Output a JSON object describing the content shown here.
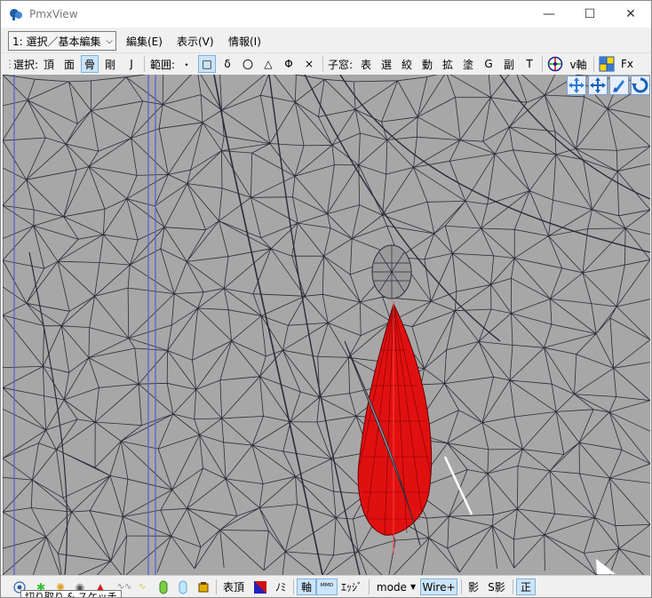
{
  "window": {
    "title": "PmxView",
    "minimize": "—",
    "maximize": "☐",
    "close": "✕"
  },
  "menu": {
    "mode_select": "1: 選択／基本編集",
    "items": [
      "編集(E)",
      "表示(V)",
      "情報(I)"
    ]
  },
  "toolbar": {
    "select_label": "選択:",
    "select_items": [
      "頂",
      "面",
      "骨",
      "剛",
      "J"
    ],
    "range_label": "範囲:",
    "range_items": [
      "・",
      "□",
      "δ",
      "〇",
      "△",
      "Φ",
      "×"
    ],
    "subwin_label": "子窓:",
    "subwin_items": [
      "表",
      "選",
      "絞",
      "動",
      "拡",
      "塗",
      "G",
      "副",
      "T"
    ],
    "v_axis": "v軸",
    "fx": "Fx"
  },
  "bottombar": {
    "labels": [
      "表頂",
      "ﾉﾐ",
      "軸",
      "ｴｯｼﾞ",
      "mode",
      "Wire+",
      "影",
      "S影",
      "正"
    ],
    "tooltip": "切り取り & スケッチ"
  },
  "colors": {
    "mesh_fill": "#a7a7a7",
    "wire": "#2b2b3a",
    "selected": "#e11010",
    "accent": "#0078d7"
  }
}
